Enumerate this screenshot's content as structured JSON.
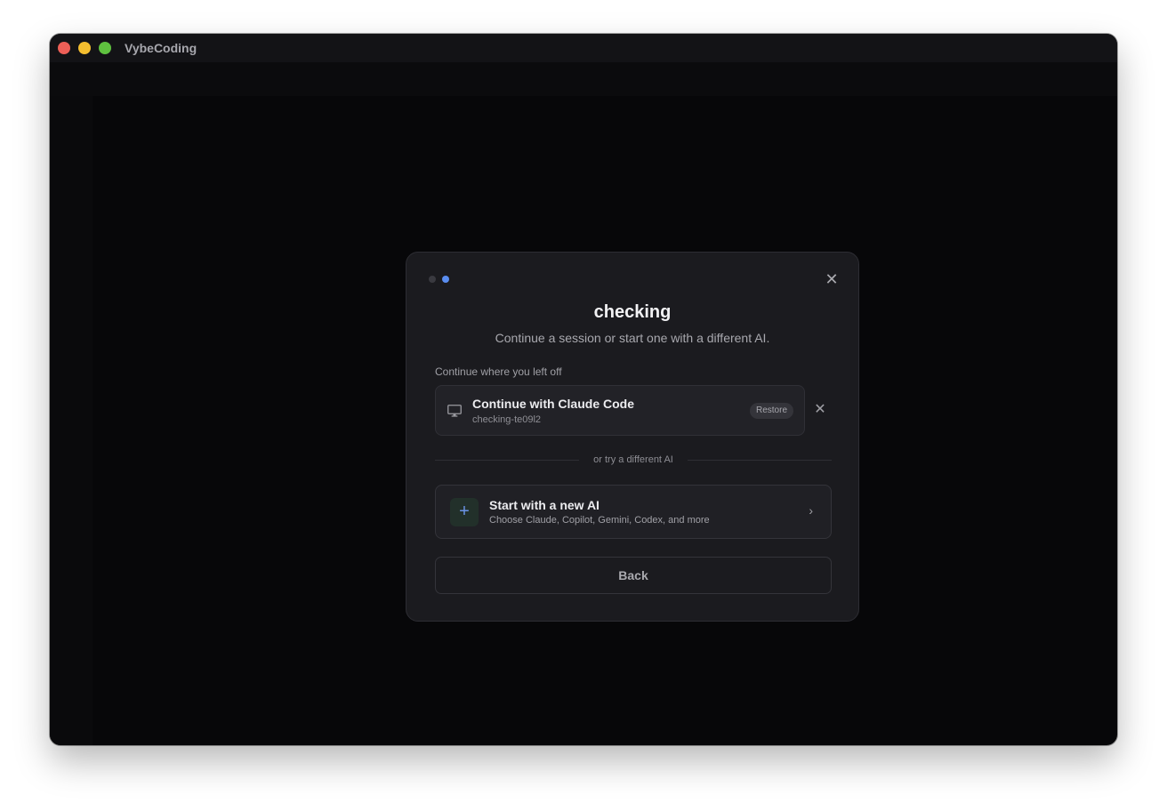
{
  "window": {
    "app_title": "VybeCoding"
  },
  "modal": {
    "step_count": 2,
    "active_step": 2,
    "title": "checking",
    "subtitle": "Continue a session or start one with a different AI.",
    "close_icon": "close-icon",
    "section_label": "Continue where you left off",
    "session": {
      "icon": "monitor-icon",
      "title": "Continue with Claude Code",
      "session_id": "checking-te09l2",
      "restore_label": "Restore",
      "dismiss_icon": "close-icon"
    },
    "divider_text": "or try a different AI",
    "new_ai": {
      "icon": "plus-icon",
      "icon_glyph": "+",
      "title": "Start with a new AI",
      "description": "Choose Claude, Copilot, Gemini, Codex, and more",
      "chevron_icon": "chevron-right-icon"
    },
    "back_label": "Back"
  },
  "colors": {
    "accent_blue": "#5a8df0",
    "window_bg": "#070709",
    "modal_bg": "#1b1b1f"
  }
}
